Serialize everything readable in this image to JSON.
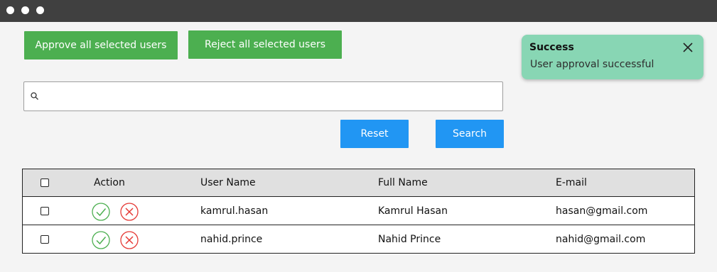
{
  "window": {
    "controls": [
      "dot-1",
      "dot-2",
      "dot-3"
    ]
  },
  "toolbar": {
    "approve_label": "Approve all selected users",
    "reject_label": "Reject all selected users"
  },
  "search": {
    "placeholder": "",
    "value": "",
    "icon": "search-icon",
    "reset_label": "Reset",
    "search_label": "Search"
  },
  "toast": {
    "title": "Success",
    "message": "User approval successful",
    "close_icon": "close-icon"
  },
  "table": {
    "headers": {
      "select": "",
      "action": "Action",
      "username": "User Name",
      "fullname": "Full Name",
      "email": "E-mail"
    },
    "rows": [
      {
        "username": "kamrul.hasan",
        "fullname": "Kamrul Hasan",
        "email": "hasan@gmail.com"
      },
      {
        "username": "nahid.prince",
        "fullname": "Nahid Prince",
        "email": "nahid@gmail.com"
      }
    ]
  },
  "colors": {
    "titlebar": "#404040",
    "green_button": "#4caf50",
    "blue_button": "#2196f3",
    "toast_bg": "#88d6b4",
    "approve_icon": "#4caf50",
    "reject_icon": "#e53935"
  }
}
